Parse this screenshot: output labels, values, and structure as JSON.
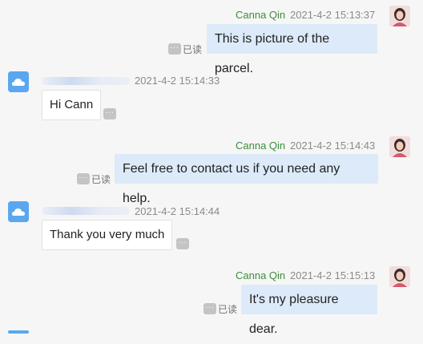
{
  "colors": {
    "background": "#f6f6f6",
    "sent_bubble": "#dceaf9",
    "received_bubble": "#ffffff",
    "sender_name": "#3c8d3c",
    "timestamp": "#8a8a8a",
    "avatar_received": "#5aa7f0"
  },
  "icons": {
    "sent_avatar": "woman-photo-avatar",
    "received_avatar": "blue-cloud-avatar",
    "more": "ellipsis-icon"
  },
  "messages": [
    {
      "direction": "sent",
      "sender": "Canna Qin",
      "time": "2021-4-2 15:13:37",
      "text": "This is picture of the parcel.",
      "status": "已读"
    },
    {
      "direction": "received",
      "sender": "",
      "time": "2021-4-2 15:14:33",
      "text": "Hi Cann"
    },
    {
      "direction": "sent",
      "sender": "Canna Qin",
      "time": "2021-4-2 15:14:43",
      "text": "Feel free to contact us if you need any help.",
      "status": "已读"
    },
    {
      "direction": "received",
      "sender": "",
      "time": "2021-4-2 15:14:44",
      "text": "Thank you very much"
    },
    {
      "direction": "sent",
      "sender": "Canna Qin",
      "time": "2021-4-2 15:15:13",
      "text": "It's my pleasure dear.",
      "status": "已读"
    }
  ]
}
